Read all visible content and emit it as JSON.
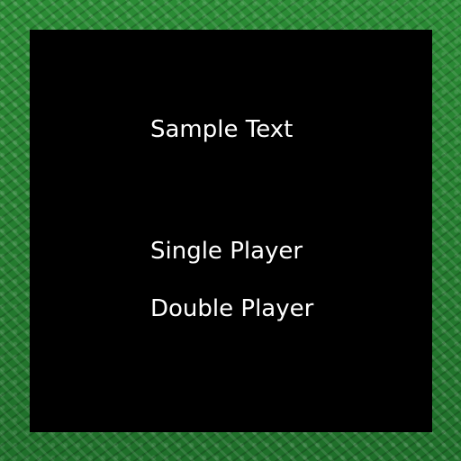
{
  "menu": {
    "sample_text": "Sample Text",
    "options": [
      {
        "label": "Single Player"
      },
      {
        "label": "Double Player"
      }
    ]
  },
  "theme": {
    "border_color": "#2b8c35",
    "background_color": "#000000",
    "text_color": "#ffffff"
  }
}
